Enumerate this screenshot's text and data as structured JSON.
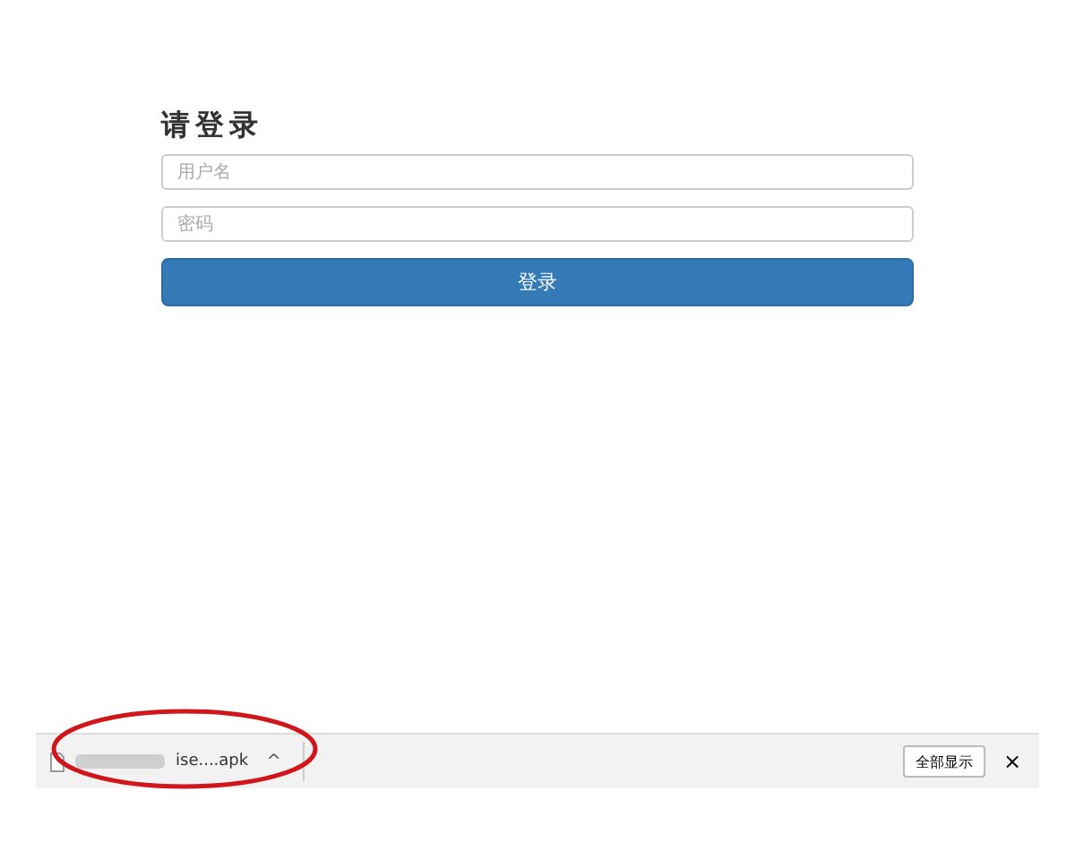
{
  "login": {
    "title": "请登录",
    "username": {
      "placeholder": "用户名"
    },
    "password": {
      "placeholder": "密码"
    },
    "submit": "登录"
  },
  "download_bar": {
    "file": {
      "name": "ise....apk",
      "caret": "^"
    },
    "show_all": "全部显示",
    "close": "×"
  },
  "annotation": {
    "kind": "ellipse",
    "color": "#d0161b"
  }
}
